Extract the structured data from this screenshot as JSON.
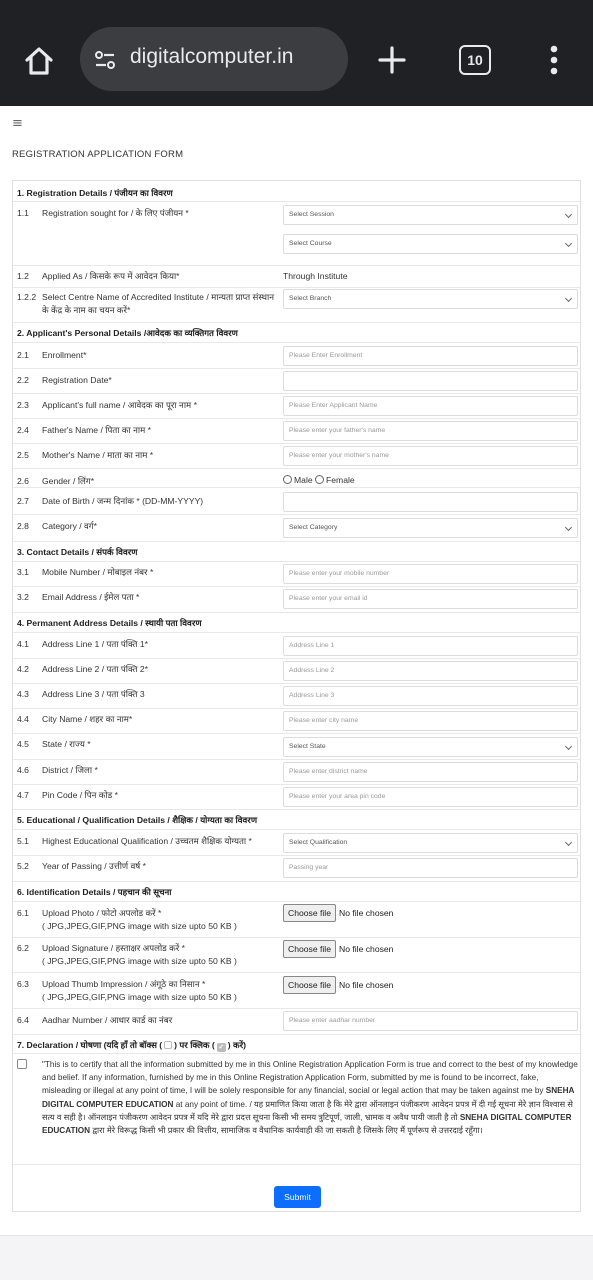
{
  "browser": {
    "url": "digitalcomputer.in",
    "tab_count": "10"
  },
  "page": {
    "menu_glyph": "≡",
    "title": "REGISTRATION APPLICATION FORM"
  },
  "sections": {
    "s1": "1. Registration Details / पंजीयन का विवरण",
    "s2": "2. Applicant's Personal Details /आवेदक का व्यक्तिगत विवरण",
    "s3": "3. Contact Details / संपर्क विवरण",
    "s4": "4. Permanent Address Details / स्थायी पता विवरण",
    "s5": "5. Educational / Qualification Details / शैक्षिक / योग्यता का विवरण",
    "s6": "6. Identification Details / पहचान की सूचना",
    "s7": "7. Declaration / घोषणा (यदि हाँ तो बॉक्स (",
    "s7b": ") पर क्लिक (",
    "s7c": ") करें)"
  },
  "rows": {
    "r11": {
      "num": "1.1",
      "label": "Registration sought for / के लिए पंजीयन *",
      "session": "Select Session",
      "course": "Select Course"
    },
    "r12": {
      "num": "1.2",
      "label": "Applied As / किसके रूप में आवेदन किया*",
      "value": "Through Institute"
    },
    "r122": {
      "num": "1.2.2",
      "label": "Select Centre Name of Accredited Institute / मान्यता प्राप्त संस्थान के केंद्र के नाम का चयन करें*",
      "value": "Select Branch"
    },
    "r21": {
      "num": "2.1",
      "label": "Enrollment*",
      "placeholder": "Please Enter Enrollment"
    },
    "r22": {
      "num": "2.2",
      "label": "Registration Date*",
      "placeholder": ""
    },
    "r23": {
      "num": "2.3",
      "label": "Applicant's full name / आवेदक का पूरा नाम *",
      "placeholder": "Please Enter Applicant Name"
    },
    "r24": {
      "num": "2.4",
      "label": "Father's Name / पिता का नाम *",
      "placeholder": "Please enter your father's name"
    },
    "r25": {
      "num": "2.5",
      "label": "Mother's Name / माता का नाम *",
      "placeholder": "Please enter your mother's name"
    },
    "r26": {
      "num": "2.6",
      "label": "Gender / लिंग*",
      "male": "Male",
      "female": "Female"
    },
    "r27": {
      "num": "2.7",
      "label": "Date of Birth / जन्म दिनांक * (DD-MM-YYYY)",
      "placeholder": ""
    },
    "r28": {
      "num": "2.8",
      "label": "Category / वर्ग*",
      "value": "Select Category"
    },
    "r31": {
      "num": "3.1",
      "label": "Mobile Number / मोबाइल नंबर *",
      "placeholder": "Please enter your mobile number"
    },
    "r32": {
      "num": "3.2",
      "label": "Email Address / ईमेल पता *",
      "placeholder": "Please enter your email id"
    },
    "r41": {
      "num": "4.1",
      "label": "Address Line 1 / पता पंक्ति 1*",
      "placeholder": "Address Line 1"
    },
    "r42": {
      "num": "4.2",
      "label": "Address Line 2 / पता पंक्ति 2*",
      "placeholder": "Address Line 2"
    },
    "r43": {
      "num": "4.3",
      "label": "Address Line 3 / पता पंक्ति 3",
      "placeholder": "Address Line 3"
    },
    "r44": {
      "num": "4.4",
      "label": "City Name / शहर का नाम*",
      "placeholder": "Please enter city name"
    },
    "r45": {
      "num": "4.5",
      "label": "State / राज्य *",
      "value": "Select State"
    },
    "r46": {
      "num": "4.6",
      "label": "District / जिला *",
      "placeholder": "Please enter district name"
    },
    "r47": {
      "num": "4.7",
      "label": "Pin Code / पिन कोड *",
      "placeholder": "Please enter your area pin code"
    },
    "r51": {
      "num": "5.1",
      "label": "Highest Educational Qualification / उच्चतम शैक्षिक योग्यता *",
      "value": "Select Qualification"
    },
    "r52": {
      "num": "5.2",
      "label": "Year of Passing / उत्तीर्ण वर्ष *",
      "placeholder": "Passing year"
    },
    "r61": {
      "num": "6.1",
      "label": "Upload Photo / फोटो अपलोड करें *",
      "hint": "( JPG,JPEG,GIF,PNG image with size upto 50 KB )"
    },
    "r62": {
      "num": "6.2",
      "label": "Upload Signature / हस्ताक्षर अपलोड करें *",
      "hint": "( JPG,JPEG,GIF,PNG image with size upto 50 KB )"
    },
    "r63": {
      "num": "6.3",
      "label": "Upload Thumb Impression / अंगूठे का निसान *",
      "hint": "( JPG,JPEG,GIF,PNG image with size upto 50 KB )"
    },
    "r64": {
      "num": "6.4",
      "label": "Aadhar Number / आधार कार्ड का नंबर",
      "placeholder": "Please enter aadhar number"
    }
  },
  "file": {
    "button": "Choose file",
    "status": "No file chosen"
  },
  "declaration": {
    "p1": "\"This is to certify that all the information submitted by me in this Online Registration Application Form is true and correct to the best of my knowledge and belief. If any information, furnished by me in this Online Registration Application Form, submitted by me is found to be incorrect, fake, misleading or illegal at any point of time, I will be solely responsible for any financial, social or legal action that may be taken against me by ",
    "org": "SNEHA DIGITAL COMPUTER EDUCATION",
    "p2": " at any point of time. / यह प्रमाणित किया जाता है कि मेरे द्वारा ऑनलाइन पंजीकरण आवेदन प्रपत्र में दी गई सूचना मेरे ज्ञान विश्वास से सत्य व सही है। ऑनलाइन पंजीकरण आवेदन प्रपत्र में यदि मेरे द्वारा प्रदत्त सूचना किसी भी समय त्रुटिपूर्ण, जाली, भ्रामक व अवैध पायी जाती है तो ",
    "p3": " द्वारा मेरे विरूद्ध किसी भी प्रकार की वित्तीय, सामाजिक व वैधानिक कार्यवाही की जा सकती है जिसके लिए मैं पूर्णरूप से उत्तरदाई रहूँगा।"
  },
  "submit_label": "Submit"
}
